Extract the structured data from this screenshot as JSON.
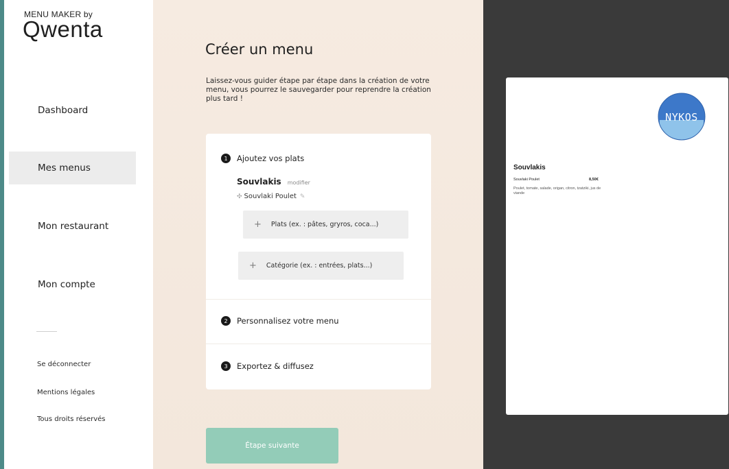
{
  "brand": {
    "small": "MENU MAKER by",
    "logo": "Qwenta"
  },
  "nav": [
    {
      "label": "Dashboard",
      "active": false
    },
    {
      "label": "Mes menus",
      "active": true
    },
    {
      "label": "Mon restaurant",
      "active": false
    },
    {
      "label": "Mon compte",
      "active": false
    }
  ],
  "footer_links": [
    "Se déconnecter",
    "Mentions légales",
    "Tous droits réservés"
  ],
  "main": {
    "title": "Créer un menu",
    "description": "Laissez-vous guider étape par étape dans la création de votre menu, vous pourrez le sauvegarder pour reprendre la création plus tard !",
    "steps": [
      {
        "number": "1",
        "label": "Ajoutez vos plats"
      },
      {
        "number": "2",
        "label": "Personnalisez votre menu"
      },
      {
        "number": "3",
        "label": "Exportez & diffusez"
      }
    ],
    "category": {
      "name": "Souvlakis",
      "edit_label": "modifier"
    },
    "dish": "Souvlaki Poulet",
    "add_dish_label": "Plats (ex. : pâtes, gryros, coca...)",
    "add_category_label": "Catégorie (ex. : entrées, plats...)",
    "next_label": "Étape suivante"
  },
  "preview": {
    "logo_text": "NYKOS",
    "category": "Souvlakis",
    "dish": "Souvlaki Poulet",
    "price": "8,50€",
    "description": "Poulet, tomate, salade, origan, citron, tzatziki, jus de viande"
  },
  "colors": {
    "frame": "#4d8a88",
    "accent_button": "#93ccb8",
    "main_bg": "#f6ebe1",
    "preview_bg": "#3a3a3a",
    "logo_blue": "#3d78c9"
  },
  "icons": {
    "step_marker": "numbered-circle-icon",
    "dish_handle": "drag-handle-icon",
    "dish_edit": "pencil-icon",
    "add": "plus-icon"
  }
}
